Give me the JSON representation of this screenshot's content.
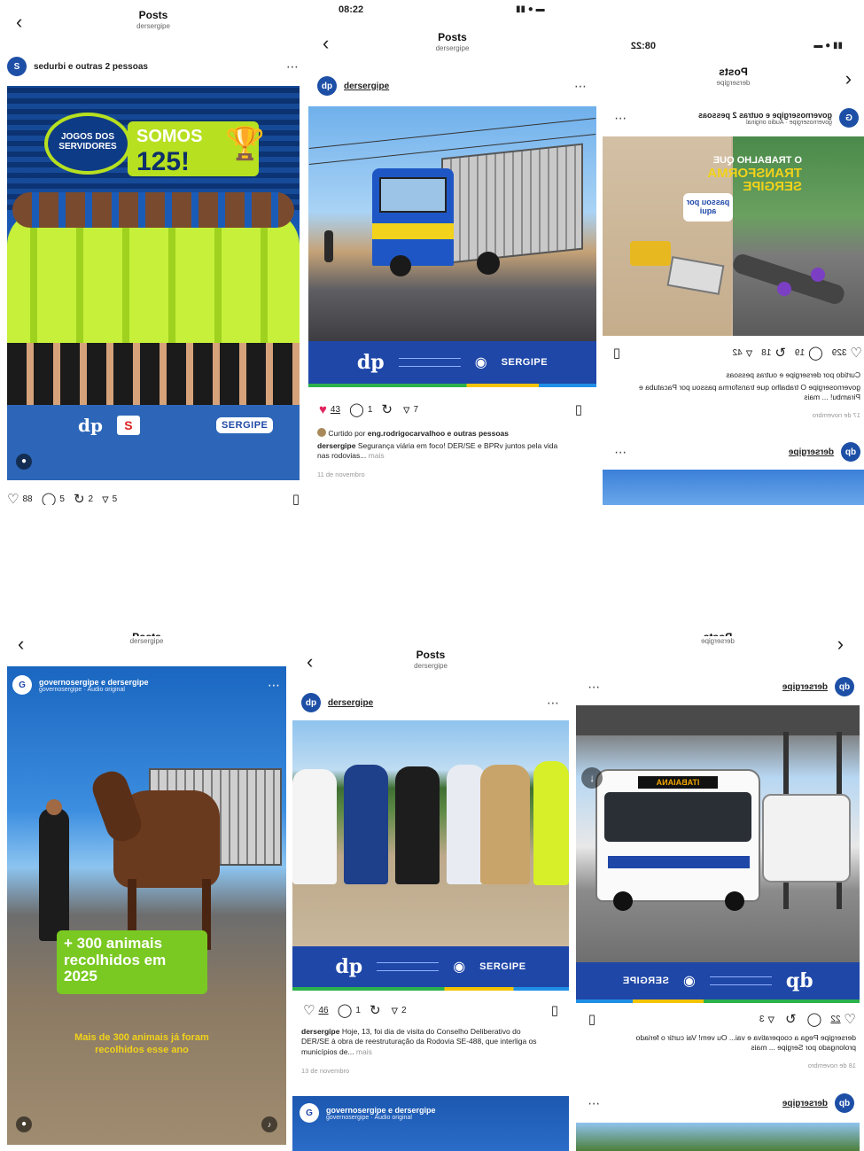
{
  "tile1": {
    "title": "Posts",
    "subtitle": "dersergipe",
    "user": "sedurbi e outras 2 pessoas",
    "badge_line1": "JOGOS DOS",
    "badge_line2": "SERVIDORES",
    "somos": "SOMOS",
    "count": "125!",
    "likes": "88",
    "comments": "5",
    "reposts": "2",
    "shares": "5"
  },
  "tile2": {
    "status_time": "08:22",
    "title": "Posts",
    "subtitle": "dersergipe",
    "user": "dersergipe",
    "banner_name": "SERGIPE",
    "likes": "43",
    "comments": "1",
    "shares": "7",
    "liked_by_prefix": "Curtido por ",
    "liked_by_user": "eng.rodrigocarvalhoo",
    "liked_by_suffix": " e outras pessoas",
    "caption_user": "dersergipe",
    "caption": " Segurança viária em foco! DER/SE e BPRv juntos pela vida nas rodovias...",
    "more": " mais",
    "date": "11 de novembro"
  },
  "tile3": {
    "status_time": "08:22",
    "title": "Posts",
    "subtitle": "dersergipe",
    "user": "governosergipe e outras 2 pessoas",
    "audio": "governosergipe · Áudio original",
    "overlay_line1": "O TRABALHO QUE",
    "overlay_line2": "TRANSFORMA",
    "overlay_line3": "SERGIPE",
    "tag": "passou por aqui",
    "likes": "329",
    "comments": "19",
    "reposts": "18",
    "shares": "42",
    "liked_by": "Curtido por dersergipe e outras pessoas",
    "caption": "governosergipe O trabalho que transforma passou por Pacatuba e Pirambu! ... mais",
    "date": "17 de novembro",
    "next_user": "dersergipe"
  },
  "tile4": {
    "title": "Posts",
    "subtitle": "dersergipe",
    "user": "governosergipe e dersergipe",
    "audio": "governosergipe · Áudio original",
    "overlay_big": "+ 300 animais recolhidos em 2025",
    "overlay_small": "Mais de 300 animais já foram recolhidos esse ano"
  },
  "tile5": {
    "title": "Posts",
    "subtitle": "dersergipe",
    "user": "dersergipe",
    "banner_name": "SERGIPE",
    "likes": "46",
    "comments": "1",
    "shares": "2",
    "caption_user": "dersergipe",
    "caption": " Hoje, 13, foi dia de visita do Conselho Deliberativo do DER/SE à obra de reestruturação da Rodovia SE-488, que interliga os municípios de...",
    "more": " mais",
    "date": "13 de novembro",
    "next_user": "governosergipe e dersergipe",
    "next_audio": "governosergipe · Áudio original"
  },
  "tile6": {
    "title": "Posts",
    "subtitle": "dersergipe",
    "user": "dersergipe",
    "banner_name": "SERGIPE",
    "bus_sign": "ITABAIANA",
    "likes": "22",
    "shares": "3",
    "caption": "dersergipe Pega a cooperativa e vai... Ou vem! Vai curtir o feriado prolongado por Sergipe ... mais",
    "date": "18 de novembro",
    "next_user": "dersergipe"
  }
}
